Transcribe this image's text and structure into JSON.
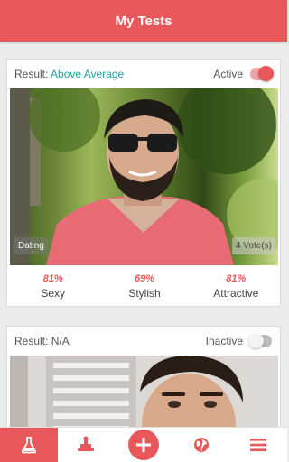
{
  "app_bar": {
    "title": "My Tests"
  },
  "tests": [
    {
      "result_prefix": "Result:",
      "result_value": "Above Average",
      "status": "Active",
      "toggle_on": true,
      "category": "Dating",
      "votes": "4 Vote(s)",
      "stats": [
        {
          "percent": "81%",
          "label": "Sexy"
        },
        {
          "percent": "69%",
          "label": "Stylish"
        },
        {
          "percent": "81%",
          "label": "Attractive"
        }
      ]
    },
    {
      "result_prefix": "Result:",
      "result_value": "N/A",
      "status": "Inactive",
      "toggle_on": false
    }
  ],
  "bottom_nav": [
    {
      "icon": "flask-icon",
      "active": true
    },
    {
      "icon": "stamp-icon",
      "active": false
    },
    {
      "icon": "plus-icon",
      "active": false
    },
    {
      "icon": "globe-icon",
      "active": false
    },
    {
      "icon": "menu-icon",
      "active": false
    }
  ],
  "colors": {
    "accent": "#e8585b",
    "result_accent": "#1aa3a3"
  }
}
